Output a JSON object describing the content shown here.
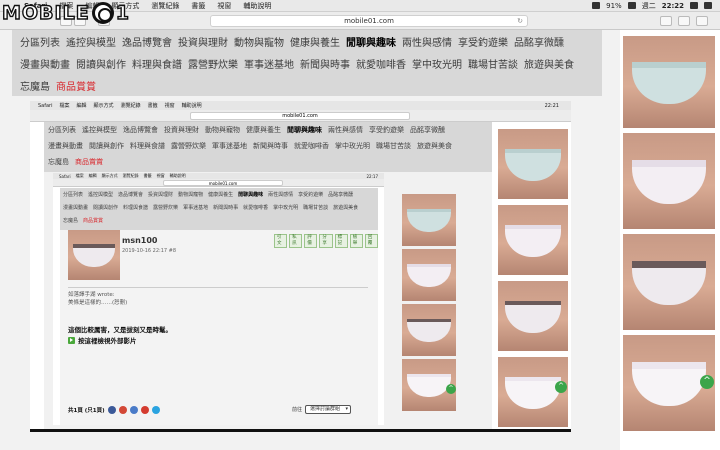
{
  "logo": {
    "text": "MOBILE01"
  },
  "menubar": {
    "app": "Safari",
    "items": [
      "檔案",
      "編輯",
      "顯示方式",
      "瀏覽紀錄",
      "書籤",
      "視窗",
      "輔助說明"
    ],
    "battery": "91%",
    "day": "週二",
    "time": "22:22"
  },
  "browser": {
    "url": "mobile01.com"
  },
  "nav": {
    "row1": [
      "分區列表",
      "遙控與模型",
      "逸品博覽會",
      "投資與理財",
      "動物與寵物",
      "健康與養生",
      "閒聊與趣味",
      "兩性與感情",
      "享受釣遊樂",
      "品酩享微醺"
    ],
    "row2": [
      "漫畫與動畫",
      "閱讀與創作",
      "料理與食譜",
      "露營野炊樂",
      "軍事迷基地",
      "新聞與時事",
      "就愛咖啡香",
      "掌中玫光明",
      "職場甘苦談",
      "旅遊與美食"
    ],
    "row3": [
      "忘魔島",
      "商品賞賞"
    ],
    "active": "閒聊與趣味",
    "highlight": "商品賞賞"
  },
  "mid": {
    "time": "22:21",
    "url": "mobile01.com"
  },
  "inner": {
    "url": "mobile01.com",
    "time": "22:17"
  },
  "post": {
    "author": "msn100",
    "date": "2019-10-16 22:17  #8",
    "tags": [
      "引文",
      "私訊",
      "評價",
      "分享",
      "標記",
      "檢舉",
      "回覆"
    ],
    "quote_author": "如落譯手湖 wrote:",
    "quote_text": "美條是這樣的……(恕刪)",
    "text": "這個比較厲害，又是拔刻又是時髦。",
    "link": "按這裡檢視外部影片"
  },
  "pager": {
    "label": "共1頁 (只1頁)",
    "jump_label": "前往",
    "jump_value": "選擇討論群組"
  },
  "colors": {
    "accent_red": "#d8262b",
    "green": "#3ba54a",
    "nav_bg": "#d8d8d8"
  }
}
